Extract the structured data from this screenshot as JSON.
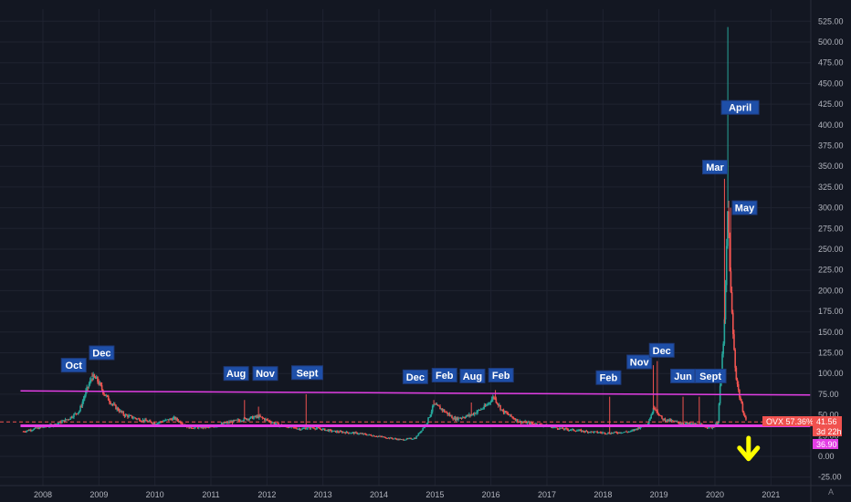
{
  "chart_data": {
    "type": "candlestick",
    "symbol": "OVX",
    "x_ticks": [
      "2008",
      "2009",
      "2010",
      "2011",
      "2012",
      "2013",
      "2014",
      "2015",
      "2016",
      "2017",
      "2018",
      "2019",
      "2020",
      "2021"
    ],
    "x_tick_years": [
      2008,
      2009,
      2010,
      2011,
      2012,
      2013,
      2014,
      2015,
      2016,
      2017,
      2018,
      2019,
      2020,
      2021
    ],
    "y_ticks": [
      "525.00",
      "500.00",
      "475.00",
      "450.00",
      "425.00",
      "400.00",
      "375.00",
      "350.00",
      "325.00",
      "300.00",
      "275.00",
      "250.00",
      "225.00",
      "200.00",
      "175.00",
      "150.00",
      "125.00",
      "100.00",
      "75.00",
      "50.00",
      "25.00",
      "0.00",
      "-25.00"
    ],
    "y_tick_values": [
      525,
      500,
      475,
      450,
      425,
      400,
      375,
      350,
      325,
      300,
      275,
      250,
      225,
      200,
      175,
      150,
      125,
      100,
      75,
      50,
      25,
      0,
      -25
    ],
    "ylim": [
      -35,
      545
    ],
    "xlim": [
      2007.6,
      2021.8
    ],
    "series": [
      {
        "date": 2007.65,
        "value": 30
      },
      {
        "date": 2007.9,
        "value": 34
      },
      {
        "date": 2008.2,
        "value": 38
      },
      {
        "date": 2008.45,
        "value": 45
      },
      {
        "date": 2008.65,
        "value": 55
      },
      {
        "date": 2008.78,
        "value": 80
      },
      {
        "date": 2008.88,
        "value": 96
      },
      {
        "date": 2008.97,
        "value": 92
      },
      {
        "date": 2009.1,
        "value": 75
      },
      {
        "date": 2009.25,
        "value": 62
      },
      {
        "date": 2009.45,
        "value": 50
      },
      {
        "date": 2009.7,
        "value": 45
      },
      {
        "date": 2010.0,
        "value": 40
      },
      {
        "date": 2010.35,
        "value": 46
      },
      {
        "date": 2010.6,
        "value": 35
      },
      {
        "date": 2011.0,
        "value": 35
      },
      {
        "date": 2011.25,
        "value": 40
      },
      {
        "date": 2011.6,
        "value": 45
      },
      {
        "date": 2011.85,
        "value": 48
      },
      {
        "date": 2012.2,
        "value": 38
      },
      {
        "date": 2012.6,
        "value": 33
      },
      {
        "date": 2012.8,
        "value": 35
      },
      {
        "date": 2013.2,
        "value": 30
      },
      {
        "date": 2013.6,
        "value": 28
      },
      {
        "date": 2014.0,
        "value": 24
      },
      {
        "date": 2014.4,
        "value": 20
      },
      {
        "date": 2014.65,
        "value": 22
      },
      {
        "date": 2014.85,
        "value": 40
      },
      {
        "date": 2014.98,
        "value": 62
      },
      {
        "date": 2015.1,
        "value": 58
      },
      {
        "date": 2015.35,
        "value": 45
      },
      {
        "date": 2015.65,
        "value": 50
      },
      {
        "date": 2015.9,
        "value": 60
      },
      {
        "date": 2016.05,
        "value": 72
      },
      {
        "date": 2016.2,
        "value": 55
      },
      {
        "date": 2016.5,
        "value": 42
      },
      {
        "date": 2016.9,
        "value": 38
      },
      {
        "date": 2017.3,
        "value": 33
      },
      {
        "date": 2017.7,
        "value": 30
      },
      {
        "date": 2018.1,
        "value": 28
      },
      {
        "date": 2018.5,
        "value": 30
      },
      {
        "date": 2018.8,
        "value": 40
      },
      {
        "date": 2018.92,
        "value": 60
      },
      {
        "date": 2019.05,
        "value": 45
      },
      {
        "date": 2019.4,
        "value": 40
      },
      {
        "date": 2019.7,
        "value": 38
      },
      {
        "date": 2019.95,
        "value": 35
      },
      {
        "date": 2020.05,
        "value": 40
      },
      {
        "date": 2020.17,
        "value": 160
      },
      {
        "date": 2020.23,
        "value": 300
      },
      {
        "date": 2020.28,
        "value": 200
      },
      {
        "date": 2020.32,
        "value": 150
      },
      {
        "date": 2020.37,
        "value": 100
      },
      {
        "date": 2020.43,
        "value": 75
      },
      {
        "date": 2020.5,
        "value": 55
      },
      {
        "date": 2020.56,
        "value": 42
      }
    ],
    "spikes": [
      {
        "date": 2008.88,
        "value": 101
      },
      {
        "date": 2011.6,
        "value": 68
      },
      {
        "date": 2011.85,
        "value": 60
      },
      {
        "date": 2012.7,
        "value": 75
      },
      {
        "date": 2014.98,
        "value": 68
      },
      {
        "date": 2015.65,
        "value": 65
      },
      {
        "date": 2016.08,
        "value": 80
      },
      {
        "date": 2018.12,
        "value": 72
      },
      {
        "date": 2018.9,
        "value": 110
      },
      {
        "date": 2018.97,
        "value": 115
      },
      {
        "date": 2019.43,
        "value": 72
      },
      {
        "date": 2019.72,
        "value": 72
      },
      {
        "date": 2020.17,
        "value": 335
      },
      {
        "date": 2020.23,
        "value": 518
      },
      {
        "date": 2020.28,
        "value": 300
      }
    ],
    "annotations": [
      {
        "label": "Oct",
        "date": 2008.55,
        "value": 110
      },
      {
        "label": "Dec",
        "date": 2009.05,
        "value": 125
      },
      {
        "label": "Aug",
        "date": 2011.45,
        "value": 100
      },
      {
        "label": "Nov",
        "date": 2011.97,
        "value": 100
      },
      {
        "label": "Sept",
        "date": 2012.72,
        "value": 101
      },
      {
        "label": "Dec",
        "date": 2014.65,
        "value": 96
      },
      {
        "label": "Feb",
        "date": 2015.17,
        "value": 98
      },
      {
        "label": "Aug",
        "date": 2015.67,
        "value": 97
      },
      {
        "label": "Feb",
        "date": 2016.18,
        "value": 98
      },
      {
        "label": "Feb",
        "date": 2018.1,
        "value": 95
      },
      {
        "label": "Nov",
        "date": 2018.65,
        "value": 114
      },
      {
        "label": "Dec",
        "date": 2019.05,
        "value": 128
      },
      {
        "label": "Jun",
        "date": 2019.43,
        "value": 97
      },
      {
        "label": "Sept",
        "date": 2019.92,
        "value": 97
      },
      {
        "label": "Mar",
        "date": 2020.0,
        "value": 349
      },
      {
        "label": "April",
        "date": 2020.45,
        "value": 421
      },
      {
        "label": "May",
        "date": 2020.53,
        "value": 300
      }
    ],
    "trendlines": [
      {
        "name": "upper-trendline",
        "from": [
          2007.6,
          79
        ],
        "to": [
          2021.7,
          74
        ],
        "color": "#e33ee5"
      },
      {
        "name": "lower-support-line",
        "from": [
          2007.6,
          36.9
        ],
        "to": [
          2021.7,
          36.9
        ],
        "color": "#e33ee5"
      }
    ],
    "price_line": {
      "value": 41.56,
      "color": "#f0524f"
    },
    "badges": {
      "ovx_label": "OVX 57.36%",
      "price": "41.56",
      "countdown": "3d 22h",
      "support_value": "36.90"
    },
    "arrow": {
      "date": 2020.6,
      "from_value": 22,
      "to_value": -3,
      "color": "#ffff00"
    },
    "colors": {
      "background": "#131722",
      "grid": "#1f2330",
      "up": "#26a69a",
      "down": "#ef5350",
      "annotation_bg": "#1e4fa8",
      "magenta": "#e33ee5"
    },
    "grid": true
  },
  "ui": {
    "auto_scale_label": "A"
  }
}
